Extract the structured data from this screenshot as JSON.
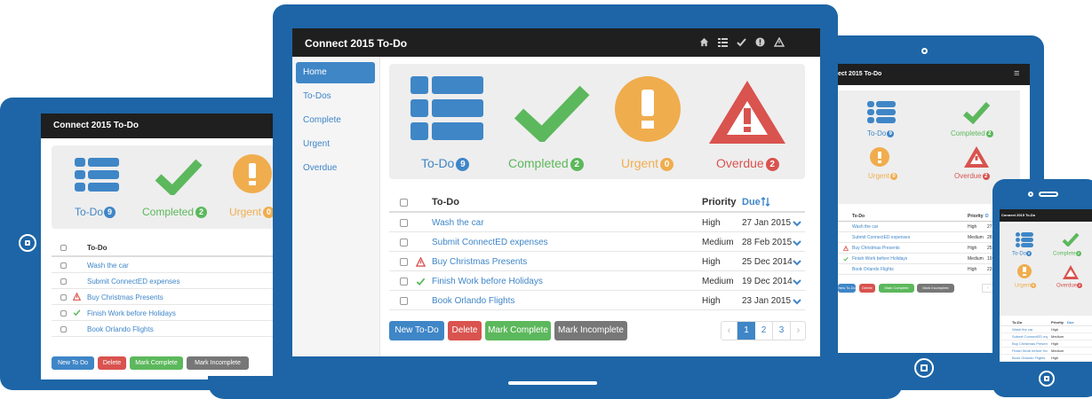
{
  "app": {
    "title": "Connect 2015 To-Do",
    "title_cropped": "ect 2015 To-Do",
    "title_phone": "Connect 2015 To-Do"
  },
  "sidebar": {
    "items": [
      {
        "label": "Home",
        "active": true
      },
      {
        "label": "To-Dos"
      },
      {
        "label": "Complete"
      },
      {
        "label": "Urgent"
      },
      {
        "label": "Overdue"
      }
    ]
  },
  "dashboard": {
    "todo": {
      "label": "To-Do",
      "count": "9"
    },
    "completed": {
      "label": "Completed",
      "count": "2",
      "label_small": "Completed",
      "label_phone": "Complete"
    },
    "urgent": {
      "label": "Urgent",
      "count": "0"
    },
    "overdue": {
      "label": "Overdue",
      "count": "2"
    }
  },
  "table": {
    "headers": {
      "todo": "To-Do",
      "priority": "Priority",
      "due": "Due",
      "sort_icon": "sort-icon"
    },
    "rows": [
      {
        "task": "Wash the car",
        "priority": "High",
        "due": "27 Jan 2015",
        "status": ""
      },
      {
        "task": "Submit ConnectED expenses",
        "priority": "Medium",
        "due": "28 Feb 2015",
        "status": ""
      },
      {
        "task": "Buy Christmas Presents",
        "priority": "High",
        "due": "25 Dec 2014",
        "status": "overdue"
      },
      {
        "task": "Finish Work before Holidays",
        "priority": "Medium",
        "due": "19 Dec 2014",
        "status": "completed"
      },
      {
        "task": "Book Orlando Flights",
        "priority": "High",
        "due": "23 Jan 2015",
        "status": ""
      }
    ],
    "tablet_left_rows": [
      "Wash the car",
      "Submit ConnectED expenses",
      "Buy Christmas Presents",
      "Finish Work before Holidays",
      "Book Orlando Flights"
    ],
    "tablet_right_rows": [
      {
        "task": "Wash the car",
        "priority": "High",
        "due": "27"
      },
      {
        "task": "Submit ConnectED expenses",
        "priority": "Medium",
        "due": "28"
      },
      {
        "task": "Buy Christmas Presents",
        "priority": "High",
        "due": "25"
      },
      {
        "task": "Finish Work before Holidays",
        "priority": "Medium",
        "due": "19"
      },
      {
        "task": "Book Orlando Flights",
        "priority": "High",
        "due": "23"
      }
    ],
    "tablet_right_headers": {
      "todo": "To-Do",
      "priority": "Priority",
      "due": "D"
    }
  },
  "phone": {
    "headers": {
      "todo": "To-Do",
      "priority": "Priority",
      "due": "Due"
    },
    "rows": [
      {
        "task": "Wash the car",
        "priority": "High"
      },
      {
        "task": "Submit ConnectED expenses",
        "priority": "Medium"
      },
      {
        "task": "Buy Christmas Presents",
        "priority": "High"
      },
      {
        "task": "Finish Work before Holidays",
        "priority": "Medium"
      },
      {
        "task": "Book Orlando Flights",
        "priority": "High"
      }
    ]
  },
  "buttons": {
    "new": "New To-Do",
    "new_small": "New To Do",
    "new_right": "New To-Do",
    "delete": "Delete",
    "mark_complete": "Mark Complete",
    "mark_incomplete": "Mark Incomplete"
  },
  "pagination": {
    "prev": "‹",
    "pages": [
      "1",
      "2",
      "3"
    ],
    "next": "›",
    "active": "1"
  },
  "colors": {
    "device": "#1d65a6",
    "navbar": "#1f1f1f",
    "primary": "#3f86c7",
    "success": "#5cb85c",
    "warning": "#f0ad4e",
    "danger": "#d9534f",
    "gray": "#777777"
  }
}
